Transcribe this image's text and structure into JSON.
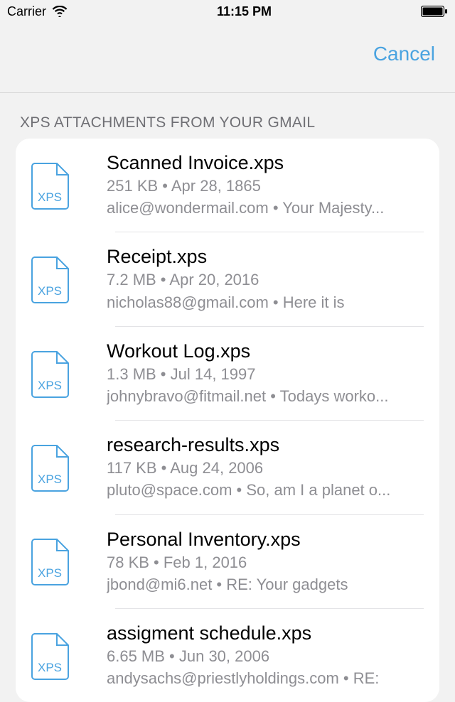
{
  "status": {
    "carrier": "Carrier",
    "time": "11:15 PM"
  },
  "nav": {
    "cancel_label": "Cancel"
  },
  "section": {
    "header": "XPS ATTACHMENTS FROM YOUR GMAIL"
  },
  "file_ext_label": "XPS",
  "items": [
    {
      "name": "Scanned Invoice.xps",
      "size": "251 KB",
      "date": "Apr 28, 1865",
      "from": "alice@wondermail.com",
      "subject": "Your Majesty..."
    },
    {
      "name": "Receipt.xps",
      "size": "7.2 MB",
      "date": "Apr 20, 2016",
      "from": "nicholas88@gmail.com",
      "subject": "Here it is"
    },
    {
      "name": "Workout Log.xps",
      "size": "1.3 MB",
      "date": "Jul 14, 1997",
      "from": "johnybravo@fitmail.net",
      "subject": "Todays worko..."
    },
    {
      "name": "research-results.xps",
      "size": "117 KB",
      "date": "Aug 24, 2006",
      "from": "pluto@space.com",
      "subject": "So, am I a planet o..."
    },
    {
      "name": "Personal Inventory.xps",
      "size": "78 KB",
      "date": "Feb 1, 2016",
      "from": "jbond@mi6.net",
      "subject": "RE: Your gadgets"
    },
    {
      "name": "assigment schedule.xps",
      "size": "6.65 MB",
      "date": "Jun 30, 2006",
      "from": "andysachs@priestlyholdings.com",
      "subject": "RE:"
    }
  ]
}
